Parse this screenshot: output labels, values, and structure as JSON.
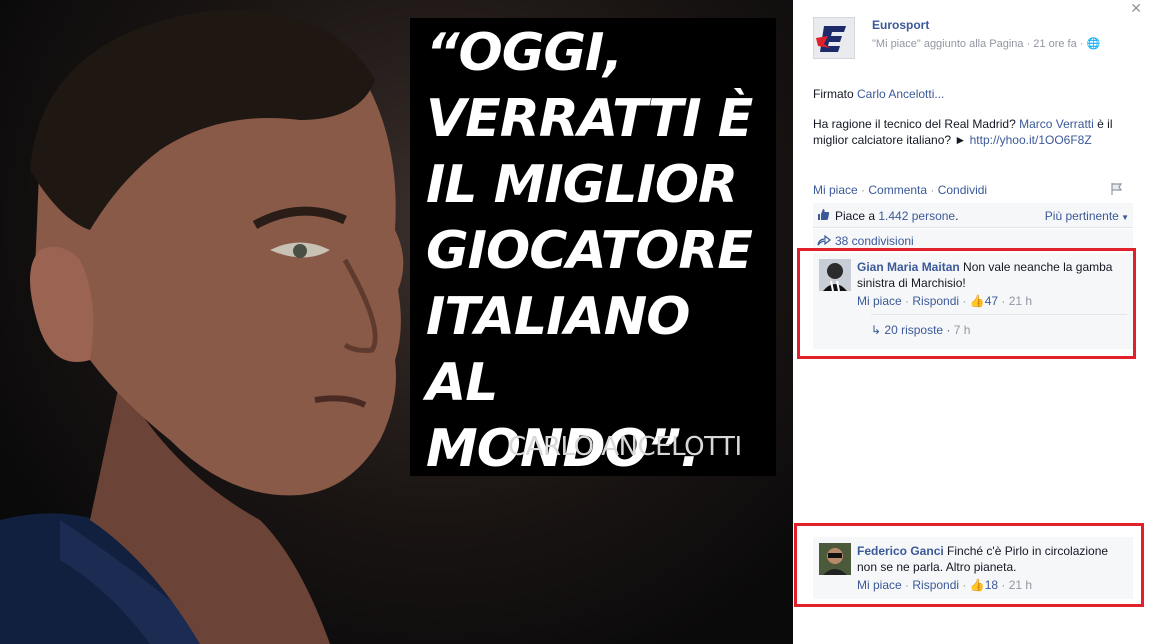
{
  "photo": {
    "quote_lines": "“OGGI,\nVERRATTI È\nIL MIGLIOR\nGIOCATORE\nITALIANO AL\nMONDO”.",
    "author": "CARLO ANCELOTTI"
  },
  "page": {
    "name": "Eurosport",
    "subtitle": "\"Mi piace\" aggiunto alla Pagina · 21 ore fa ·"
  },
  "post": {
    "line1_prefix": "Firmato ",
    "line1_link": "Carlo Ancelotti",
    "line1_suffix": "...",
    "line2_prefix": "Ha ragione il tecnico del Real Madrid? ",
    "line2_link": "Marco Verratti",
    "line2_mid": " è il miglior calciatore italiano? ► ",
    "line2_url": "http://yhoo.it/1OO6F8Z"
  },
  "actions": {
    "like": "Mi piace",
    "comment": "Commenta",
    "share": "Condividi",
    "sep": " · "
  },
  "likes": {
    "prefix": "Piace a ",
    "count": "1.442 persone",
    "suffix": ".",
    "sort": "Più pertinente"
  },
  "shares": {
    "text": "38 condivisioni"
  },
  "comments": [
    {
      "author": "Gian Maria Maitan",
      "text": "Non vale neanche la gamba sinistra di Marchisio!",
      "like": "Mi piace",
      "reply": "Rispondi",
      "likes": "47",
      "time": "21 h",
      "replies": "20 risposte",
      "replies_time": "7 h"
    },
    {
      "author": "Federico Ganci",
      "text": "Finché c'è Pirlo in circolazione non se ne parla. Altro pianeta.",
      "like": "Mi piace",
      "reply": "Rispondi",
      "likes": "18",
      "time": "21 h"
    }
  ],
  "colors": {
    "brand": "#3b5998",
    "highlight": "#e0212c",
    "muted": "#9197a3"
  },
  "icons": {
    "close": "close-icon",
    "globe": "globe-icon",
    "thumbs": "thumbs-up-icon",
    "share": "share-arrow-icon",
    "flag": "flag-icon",
    "reply": "reply-arrow-icon"
  }
}
